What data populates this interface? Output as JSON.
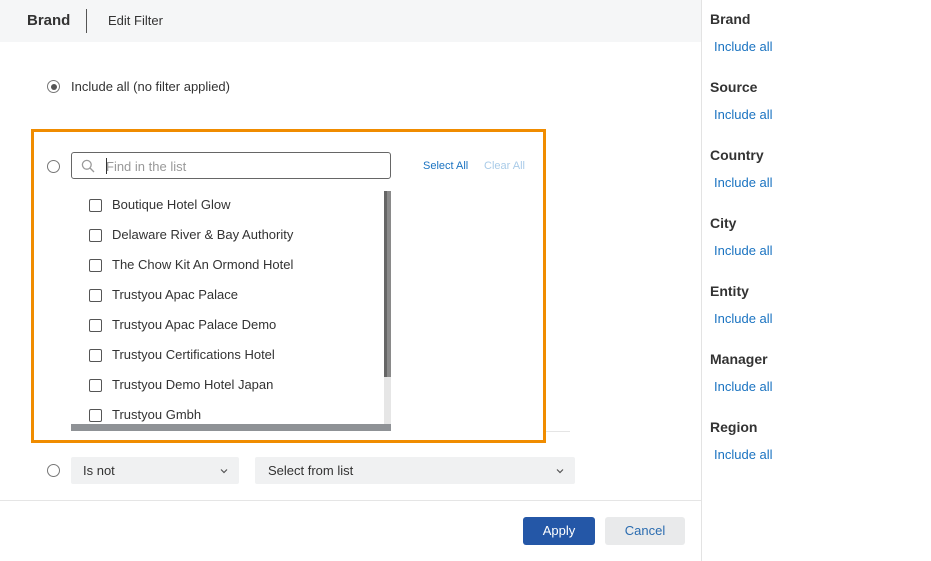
{
  "header": {
    "title": "Brand",
    "subtitle": "Edit Filter"
  },
  "options": {
    "include_all_label": "Include all (no filter applied)"
  },
  "search": {
    "placeholder": "Find in the list",
    "icon": "search-icon"
  },
  "list_actions": {
    "select_all": "Select All",
    "clear_all": "Clear All"
  },
  "list_items": [
    "Boutique Hotel Glow",
    "Delaware River & Bay Authority",
    "The Chow Kit An Ormond Hotel",
    "Trustyou Apac Palace",
    "Trustyou Apac Palace Demo",
    "Trustyou Certifications Hotel",
    "Trustyou Demo Hotel Japan",
    "Trustyou Gmbh"
  ],
  "condition": {
    "operator": "Is not",
    "value_placeholder": "Select from list"
  },
  "buttons": {
    "apply": "Apply",
    "cancel": "Cancel"
  },
  "sidebar": [
    {
      "title": "Brand",
      "value": "Include all"
    },
    {
      "title": "Source",
      "value": "Include all"
    },
    {
      "title": "Country",
      "value": "Include all"
    },
    {
      "title": "City",
      "value": "Include all"
    },
    {
      "title": "Entity",
      "value": "Include all"
    },
    {
      "title": "Manager",
      "value": "Include all"
    },
    {
      "title": "Region",
      "value": "Include all"
    }
  ],
  "colors": {
    "accent": "#1a73c1",
    "apply_button": "#2457a7",
    "highlight_frame": "#f08c00"
  }
}
